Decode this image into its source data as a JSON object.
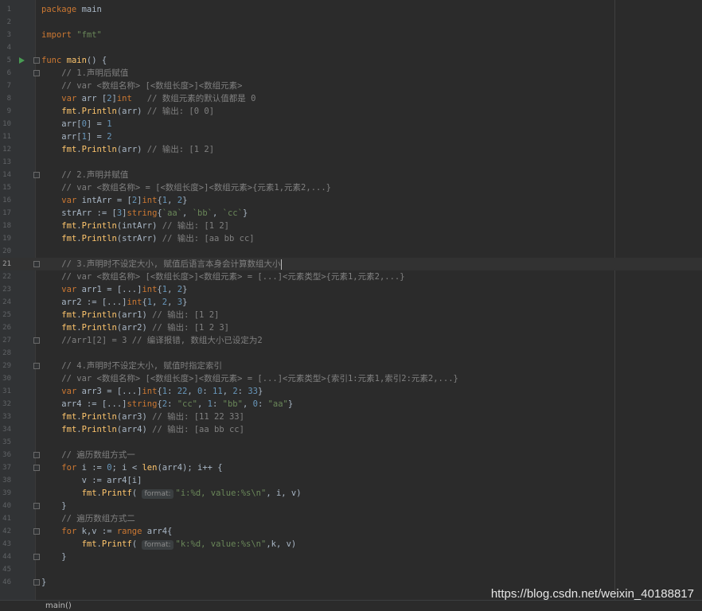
{
  "editor": {
    "language": "go",
    "current_line": 21,
    "lines": [
      {
        "n": 1,
        "fold": false,
        "run": false,
        "tokens": [
          [
            "k",
            "package"
          ],
          [
            "p",
            " main"
          ]
        ]
      },
      {
        "n": 2,
        "tokens": []
      },
      {
        "n": 3,
        "tokens": [
          [
            "k",
            "import"
          ],
          [
            "p",
            " "
          ],
          [
            "s",
            "\"fmt\""
          ]
        ]
      },
      {
        "n": 4,
        "tokens": []
      },
      {
        "n": 5,
        "fold": true,
        "run": true,
        "tokens": [
          [
            "k",
            "func"
          ],
          [
            "p",
            " "
          ],
          [
            "f",
            "main"
          ],
          [
            "p",
            "() {"
          ]
        ]
      },
      {
        "n": 6,
        "fold": true,
        "tokens": [
          [
            "p",
            "    "
          ],
          [
            "c",
            "// 1.声明后赋值"
          ]
        ]
      },
      {
        "n": 7,
        "tokens": [
          [
            "p",
            "    "
          ],
          [
            "c",
            "// var <数组名称> [<数组长度>]<数组元素>"
          ]
        ]
      },
      {
        "n": 8,
        "tokens": [
          [
            "p",
            "    "
          ],
          [
            "k",
            "var"
          ],
          [
            "p",
            " arr ["
          ],
          [
            "n",
            "2"
          ],
          [
            "p",
            "]"
          ],
          [
            "k",
            "int"
          ],
          [
            "p",
            "   "
          ],
          [
            "c",
            "// 数组元素的默认值都是 0"
          ]
        ]
      },
      {
        "n": 9,
        "tokens": [
          [
            "p",
            "    "
          ],
          [
            "f",
            "fmt"
          ],
          [
            "p",
            "."
          ],
          [
            "f",
            "Println"
          ],
          [
            "p",
            "(arr) "
          ],
          [
            "c",
            "// 输出: [0 0]"
          ]
        ]
      },
      {
        "n": 10,
        "tokens": [
          [
            "p",
            "    arr["
          ],
          [
            "n",
            "0"
          ],
          [
            "p",
            "] = "
          ],
          [
            "n",
            "1"
          ]
        ]
      },
      {
        "n": 11,
        "tokens": [
          [
            "p",
            "    arr["
          ],
          [
            "n",
            "1"
          ],
          [
            "p",
            "] = "
          ],
          [
            "n",
            "2"
          ]
        ]
      },
      {
        "n": 12,
        "tokens": [
          [
            "p",
            "    "
          ],
          [
            "f",
            "fmt"
          ],
          [
            "p",
            "."
          ],
          [
            "f",
            "Println"
          ],
          [
            "p",
            "(arr) "
          ],
          [
            "c",
            "// 输出: [1 2]"
          ]
        ]
      },
      {
        "n": 13,
        "tokens": []
      },
      {
        "n": 14,
        "fold": true,
        "tokens": [
          [
            "p",
            "    "
          ],
          [
            "c",
            "// 2.声明并赋值"
          ]
        ]
      },
      {
        "n": 15,
        "tokens": [
          [
            "p",
            "    "
          ],
          [
            "c",
            "// var <数组名称> = [<数组长度>]<数组元素>{元素1,元素2,...}"
          ]
        ]
      },
      {
        "n": 16,
        "tokens": [
          [
            "p",
            "    "
          ],
          [
            "k",
            "var"
          ],
          [
            "p",
            " intArr = ["
          ],
          [
            "n",
            "2"
          ],
          [
            "p",
            "]"
          ],
          [
            "k",
            "int"
          ],
          [
            "p",
            "{"
          ],
          [
            "n",
            "1"
          ],
          [
            "p",
            ", "
          ],
          [
            "n",
            "2"
          ],
          [
            "p",
            "}"
          ]
        ]
      },
      {
        "n": 17,
        "tokens": [
          [
            "p",
            "    strArr := ["
          ],
          [
            "n",
            "3"
          ],
          [
            "p",
            "]"
          ],
          [
            "k",
            "string"
          ],
          [
            "p",
            "{"
          ],
          [
            "s",
            "`aa`"
          ],
          [
            "p",
            ", "
          ],
          [
            "s",
            "`bb`"
          ],
          [
            "p",
            ", "
          ],
          [
            "s",
            "`cc`"
          ],
          [
            "p",
            "}"
          ]
        ]
      },
      {
        "n": 18,
        "tokens": [
          [
            "p",
            "    "
          ],
          [
            "f",
            "fmt"
          ],
          [
            "p",
            "."
          ],
          [
            "f",
            "Println"
          ],
          [
            "p",
            "(intArr) "
          ],
          [
            "c",
            "// 输出: [1 2]"
          ]
        ]
      },
      {
        "n": 19,
        "tokens": [
          [
            "p",
            "    "
          ],
          [
            "f",
            "fmt"
          ],
          [
            "p",
            "."
          ],
          [
            "f",
            "Println"
          ],
          [
            "p",
            "(strArr) "
          ],
          [
            "c",
            "// 输出: [aa bb cc]"
          ]
        ]
      },
      {
        "n": 20,
        "tokens": []
      },
      {
        "n": 21,
        "fold": true,
        "caret": true,
        "tokens": [
          [
            "p",
            "    "
          ],
          [
            "c",
            "// 3.声明时不设定大小, 赋值后语言本身会计算数组大小"
          ]
        ]
      },
      {
        "n": 22,
        "tokens": [
          [
            "p",
            "    "
          ],
          [
            "c",
            "// var <数组名称> [<数组长度>]<数组元素> = [...]<元素类型>{元素1,元素2,...}"
          ]
        ]
      },
      {
        "n": 23,
        "tokens": [
          [
            "p",
            "    "
          ],
          [
            "k",
            "var"
          ],
          [
            "p",
            " arr1 = [...]"
          ],
          [
            "k",
            "int"
          ],
          [
            "p",
            "{"
          ],
          [
            "n",
            "1"
          ],
          [
            "p",
            ", "
          ],
          [
            "n",
            "2"
          ],
          [
            "p",
            "}"
          ]
        ]
      },
      {
        "n": 24,
        "tokens": [
          [
            "p",
            "    arr2 := [...]"
          ],
          [
            "k",
            "int"
          ],
          [
            "p",
            "{"
          ],
          [
            "n",
            "1"
          ],
          [
            "p",
            ", "
          ],
          [
            "n",
            "2"
          ],
          [
            "p",
            ", "
          ],
          [
            "n",
            "3"
          ],
          [
            "p",
            "}"
          ]
        ]
      },
      {
        "n": 25,
        "tokens": [
          [
            "p",
            "    "
          ],
          [
            "f",
            "fmt"
          ],
          [
            "p",
            "."
          ],
          [
            "f",
            "Println"
          ],
          [
            "p",
            "(arr1) "
          ],
          [
            "c",
            "// 输出: [1 2]"
          ]
        ]
      },
      {
        "n": 26,
        "tokens": [
          [
            "p",
            "    "
          ],
          [
            "f",
            "fmt"
          ],
          [
            "p",
            "."
          ],
          [
            "f",
            "Println"
          ],
          [
            "p",
            "(arr2) "
          ],
          [
            "c",
            "// 输出: [1 2 3]"
          ]
        ]
      },
      {
        "n": 27,
        "fold": true,
        "tokens": [
          [
            "p",
            "    "
          ],
          [
            "c",
            "//arr1[2] = 3 // 编译报错, 数组大小已设定为2"
          ]
        ]
      },
      {
        "n": 28,
        "tokens": []
      },
      {
        "n": 29,
        "fold": true,
        "tokens": [
          [
            "p",
            "    "
          ],
          [
            "c",
            "// 4.声明时不设定大小, 赋值时指定索引"
          ]
        ]
      },
      {
        "n": 30,
        "tokens": [
          [
            "p",
            "    "
          ],
          [
            "c",
            "// var <数组名称> [<数组长度>]<数组元素> = [...]<元素类型>{索引1:元素1,索引2:元素2,...}"
          ]
        ]
      },
      {
        "n": 31,
        "tokens": [
          [
            "p",
            "    "
          ],
          [
            "k",
            "var"
          ],
          [
            "p",
            " arr3 = [...]"
          ],
          [
            "k",
            "int"
          ],
          [
            "p",
            "{"
          ],
          [
            "n",
            "1"
          ],
          [
            "p",
            ": "
          ],
          [
            "n",
            "22"
          ],
          [
            "p",
            ", "
          ],
          [
            "n",
            "0"
          ],
          [
            "p",
            ": "
          ],
          [
            "n",
            "11"
          ],
          [
            "p",
            ", "
          ],
          [
            "n",
            "2"
          ],
          [
            "p",
            ": "
          ],
          [
            "n",
            "33"
          ],
          [
            "p",
            "}"
          ]
        ]
      },
      {
        "n": 32,
        "tokens": [
          [
            "p",
            "    arr4 := [...]"
          ],
          [
            "k",
            "string"
          ],
          [
            "p",
            "{"
          ],
          [
            "n",
            "2"
          ],
          [
            "p",
            ": "
          ],
          [
            "s",
            "\"cc\""
          ],
          [
            "p",
            ", "
          ],
          [
            "n",
            "1"
          ],
          [
            "p",
            ": "
          ],
          [
            "s",
            "\"bb\""
          ],
          [
            "p",
            ", "
          ],
          [
            "n",
            "0"
          ],
          [
            "p",
            ": "
          ],
          [
            "s",
            "\"aa\""
          ],
          [
            "p",
            "}"
          ]
        ]
      },
      {
        "n": 33,
        "tokens": [
          [
            "p",
            "    "
          ],
          [
            "f",
            "fmt"
          ],
          [
            "p",
            "."
          ],
          [
            "f",
            "Println"
          ],
          [
            "p",
            "(arr3) "
          ],
          [
            "c",
            "// 输出: [11 22 33]"
          ]
        ]
      },
      {
        "n": 34,
        "tokens": [
          [
            "p",
            "    "
          ],
          [
            "f",
            "fmt"
          ],
          [
            "p",
            "."
          ],
          [
            "f",
            "Println"
          ],
          [
            "p",
            "(arr4) "
          ],
          [
            "c",
            "// 输出: [aa bb cc]"
          ]
        ]
      },
      {
        "n": 35,
        "tokens": []
      },
      {
        "n": 36,
        "fold": true,
        "tokens": [
          [
            "p",
            "    "
          ],
          [
            "c",
            "// 遍历数组方式一"
          ]
        ]
      },
      {
        "n": 37,
        "fold": true,
        "tokens": [
          [
            "p",
            "    "
          ],
          [
            "k",
            "for"
          ],
          [
            "p",
            " i := "
          ],
          [
            "n",
            "0"
          ],
          [
            "p",
            "; i < "
          ],
          [
            "f",
            "len"
          ],
          [
            "p",
            "(arr4); i++ {"
          ]
        ]
      },
      {
        "n": 38,
        "tokens": [
          [
            "p",
            "        v := arr4[i]"
          ]
        ]
      },
      {
        "n": 39,
        "tokens": [
          [
            "p",
            "        "
          ],
          [
            "f",
            "fmt"
          ],
          [
            "p",
            "."
          ],
          [
            "f",
            "Printf"
          ],
          [
            "p",
            "( "
          ],
          [
            "h",
            "format:"
          ],
          [
            "s",
            "\"i:%d, value:%s\\n\""
          ],
          [
            "p",
            ", i, v)"
          ]
        ]
      },
      {
        "n": 40,
        "fold": true,
        "tokens": [
          [
            "p",
            "    }"
          ]
        ]
      },
      {
        "n": 41,
        "tokens": [
          [
            "p",
            "    "
          ],
          [
            "c",
            "// 遍历数组方式二"
          ]
        ]
      },
      {
        "n": 42,
        "fold": true,
        "tokens": [
          [
            "p",
            "    "
          ],
          [
            "k",
            "for"
          ],
          [
            "p",
            " k,v := "
          ],
          [
            "k",
            "range"
          ],
          [
            "p",
            " arr4{"
          ]
        ]
      },
      {
        "n": 43,
        "tokens": [
          [
            "p",
            "        "
          ],
          [
            "f",
            "fmt"
          ],
          [
            "p",
            "."
          ],
          [
            "f",
            "Printf"
          ],
          [
            "p",
            "( "
          ],
          [
            "h",
            "format:"
          ],
          [
            "s",
            "\"k:%d, value:%s\\n\""
          ],
          [
            "p",
            ",k, v)"
          ]
        ]
      },
      {
        "n": 44,
        "fold": true,
        "tokens": [
          [
            "p",
            "    }"
          ]
        ]
      },
      {
        "n": 45,
        "tokens": []
      },
      {
        "n": 46,
        "fold": true,
        "tokens": [
          [
            "p",
            "}"
          ]
        ]
      }
    ]
  },
  "breadcrumb": {
    "label": "main()"
  },
  "watermark": {
    "text": "https://blog.csdn.net/weixin_40188817"
  },
  "colors": {
    "background": "#2b2b2b",
    "gutter": "#313335",
    "keyword": "#cc7832",
    "string": "#6a8759",
    "number": "#6897bb",
    "comment": "#808080",
    "function": "#ffc66d",
    "plain": "#a9b7c6"
  }
}
